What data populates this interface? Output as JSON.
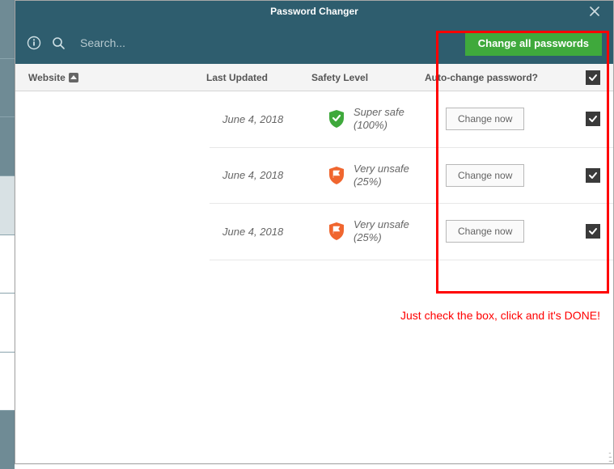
{
  "window": {
    "title": "Password Changer"
  },
  "toolbar": {
    "search_placeholder": "Search...",
    "change_all_label": "Change all passwords"
  },
  "columns": {
    "website": "Website",
    "last_updated": "Last Updated",
    "safety": "Safety Level",
    "auto": "Auto-change password?"
  },
  "header_checked": true,
  "rows": [
    {
      "updated": "June 4, 2018",
      "safety_label": "Super safe",
      "safety_pct": "(100%)",
      "safety_color": "#3fa93c",
      "safety_icon": "check",
      "change_label": "Change now",
      "checked": true
    },
    {
      "updated": "June 4, 2018",
      "safety_label": "Very unsafe",
      "safety_pct": "(25%)",
      "safety_color": "#f0662f",
      "safety_icon": "flag",
      "change_label": "Change now",
      "checked": true
    },
    {
      "updated": "June 4, 2018",
      "safety_label": "Very unsafe",
      "safety_pct": "(25%)",
      "safety_color": "#f0662f",
      "safety_icon": "flag",
      "change_label": "Change now",
      "checked": true
    }
  ],
  "annotation": {
    "text": "Just check the box, click and it's DONE!"
  }
}
